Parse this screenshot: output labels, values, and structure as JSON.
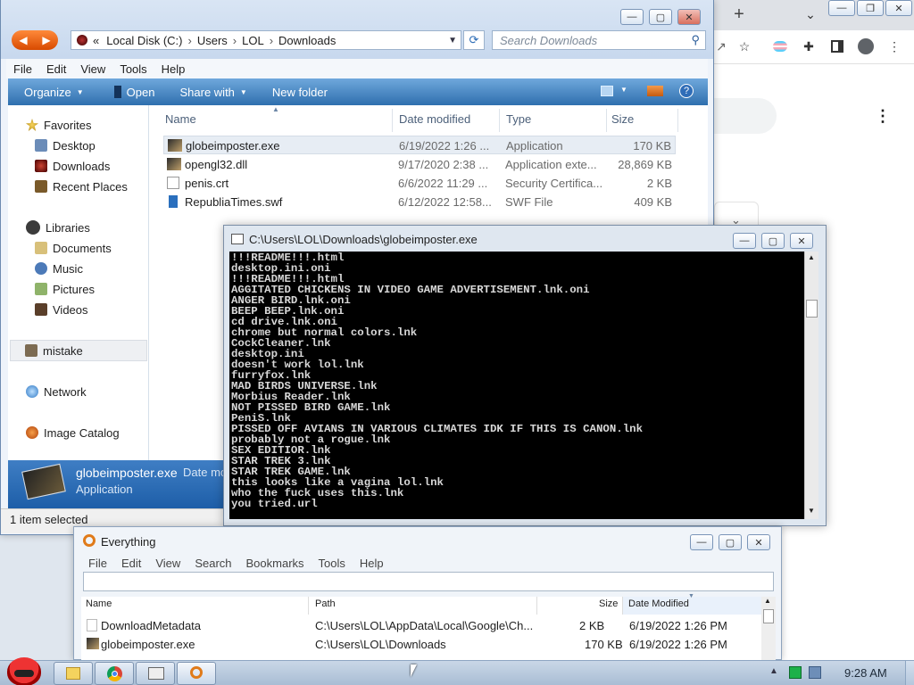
{
  "explorer": {
    "breadcrumb": [
      "«",
      "Local Disk (C:)",
      "Users",
      "LOL",
      "Downloads"
    ],
    "search_placeholder": "Search Downloads",
    "menu": [
      "File",
      "Edit",
      "View",
      "Tools",
      "Help"
    ],
    "commands": [
      "Organize",
      "Open",
      "Share with",
      "New folder"
    ],
    "nav": {
      "favorites": "Favorites",
      "desktop": "Desktop",
      "downloads": "Downloads",
      "recent": "Recent Places",
      "libraries": "Libraries",
      "documents": "Documents",
      "music": "Music",
      "pictures": "Pictures",
      "videos": "Videos",
      "mistake": "mistake",
      "network": "Network",
      "image_catalog": "Image Catalog"
    },
    "columns": {
      "name": "Name",
      "date": "Date modified",
      "type": "Type",
      "size": "Size"
    },
    "files": [
      {
        "name": "globeimposter.exe",
        "date": "6/19/2022 1:26 ...",
        "type": "Application",
        "size": "170 KB"
      },
      {
        "name": "opengl32.dll",
        "date": "9/17/2020 2:38 ...",
        "type": "Application exte...",
        "size": "28,869 KB"
      },
      {
        "name": "penis.crt",
        "date": "6/6/2022 11:29 ...",
        "type": "Security Certifica...",
        "size": "2 KB"
      },
      {
        "name": "RepubliaTimes.swf",
        "date": "6/12/2022 12:58...",
        "type": "SWF File",
        "size": "409 KB"
      }
    ],
    "details": {
      "name": "globeimposter.exe",
      "date_label": "Date mo",
      "type": "Application"
    },
    "status": "1 item selected"
  },
  "cmd": {
    "title": "C:\\Users\\LOL\\Downloads\\globeimposter.exe",
    "lines": [
      "!!!README!!!.html",
      "desktop.ini.oni",
      "!!!README!!!.html",
      "AGGITATED CHICKENS IN VIDEO GAME ADVERTISEMENT.lnk.oni",
      "ANGER BIRD.lnk.oni",
      "BEEP BEEP.lnk.oni",
      "cd drive.lnk.oni",
      "chrome but normal colors.lnk",
      "CockCleaner.lnk",
      "desktop.ini",
      "doesn't work lol.lnk",
      "furryfox.lnk",
      "MAD BIRDS UNIVERSE.lnk",
      "Morbius Reader.lnk",
      "NOT PISSED BIRD GAME.lnk",
      "PeniS.lnk",
      "PISSED OFF AVIANS IN VARIOUS CLIMATES IDK IF THIS IS CANON.lnk",
      "probably not a rogue.lnk",
      "SEX EDITIOR.lnk",
      "STAR TREK 3.lnk",
      "STAR TREK GAME.lnk",
      "this looks like a vagina lol.lnk",
      "who the fuck uses this.lnk",
      "you tried.url"
    ]
  },
  "everything": {
    "title": "Everything",
    "menu": [
      "File",
      "Edit",
      "View",
      "Search",
      "Bookmarks",
      "Tools",
      "Help"
    ],
    "columns": {
      "name": "Name",
      "path": "Path",
      "size": "Size",
      "date": "Date Modified"
    },
    "rows": [
      {
        "name": "DownloadMetadata",
        "path": "C:\\Users\\LOL\\AppData\\Local\\Google\\Ch...",
        "size": "2 KB",
        "date": "6/19/2022 1:26 PM"
      },
      {
        "name": "globeimposter.exe",
        "path": "C:\\Users\\LOL\\Downloads",
        "size": "170 KB",
        "date": "6/19/2022 1:26 PM"
      }
    ]
  },
  "taskbar": {
    "clock": "9:28 AM"
  },
  "colors": {
    "console_bg": "#000000",
    "console_fg": "#d8d8d8",
    "cmdbar": "#3d7fc0",
    "selection": "#e5eef9"
  }
}
